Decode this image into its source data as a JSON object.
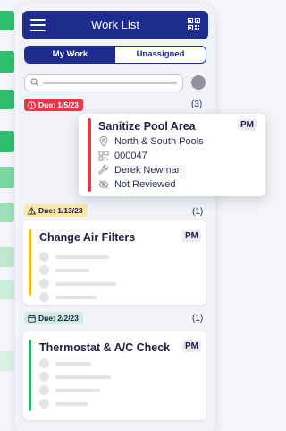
{
  "header": {
    "title": "Work List"
  },
  "tabs": [
    {
      "label": "My Work",
      "active": true
    },
    {
      "label": "Unassigned",
      "active": false
    }
  ],
  "search": {
    "placeholder": ""
  },
  "groups": [
    {
      "due": "Due: 1/5/23",
      "count": "(3)",
      "status_color": "#e0394a",
      "icon": "alert-circle-icon"
    },
    {
      "due": "Due: 1/13/23",
      "count": "(1)",
      "status_color": "#f2b81f",
      "icon": "warning-triangle-icon"
    },
    {
      "due": "Due: 2/2/23",
      "count": "(1)",
      "status_color": "#2eb36b",
      "icon": "calendar-icon"
    }
  ],
  "popup": {
    "title": "Sanitize Pool Area",
    "tag": "PM",
    "location": "North & South Pools",
    "asset_id": "000047",
    "assignee": "Derek Newman",
    "review_status": "Not Reviewed"
  },
  "cards": [
    {
      "title": "Change Air Filters",
      "tag": "PM"
    },
    {
      "title": "Thermostat & A/C Check",
      "tag": "PM"
    }
  ]
}
